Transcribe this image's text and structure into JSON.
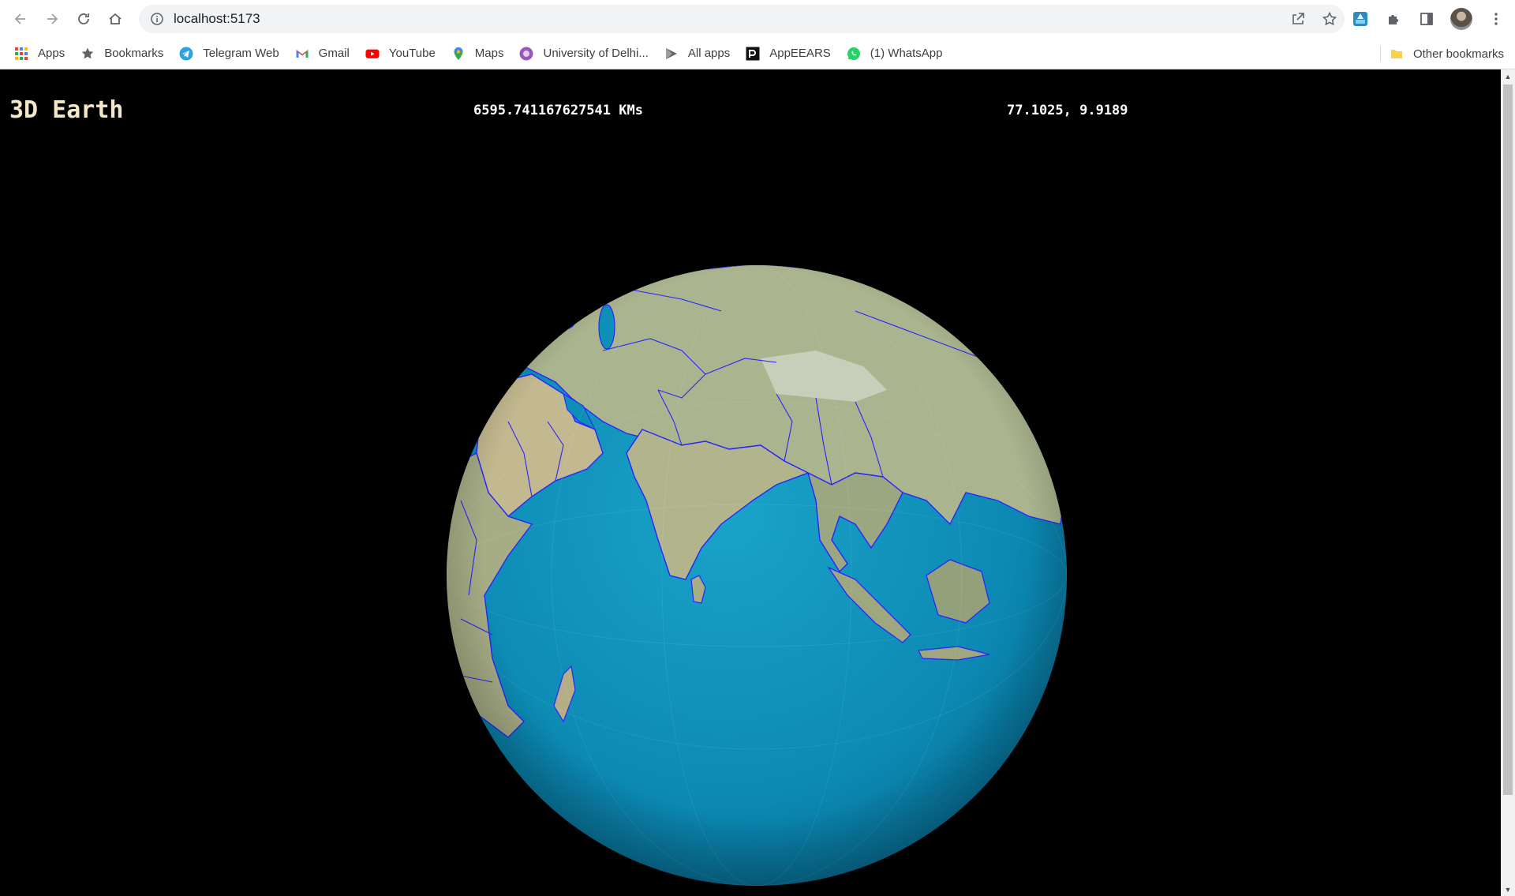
{
  "browser": {
    "url": "localhost:5173",
    "nav": {
      "back_icon": "arrow-left-icon",
      "forward_icon": "arrow-right-icon",
      "reload_icon": "reload-icon",
      "home_icon": "home-icon"
    },
    "omnibox_icons": [
      "info-icon",
      "share-icon",
      "star-icon"
    ],
    "extension_icons": [
      "appeears-extension-icon",
      "puzzle-icon",
      "side-panel-icon",
      "profile-avatar",
      "kebab-menu-icon"
    ]
  },
  "bookmarks": {
    "items": [
      {
        "label": "Apps",
        "icon": "apps-grid-icon",
        "color": "#4285f4"
      },
      {
        "label": "Bookmarks",
        "icon": "star-icon",
        "color": "#5f6368"
      },
      {
        "label": "Telegram Web",
        "icon": "telegram-icon",
        "color": "#2aa3df"
      },
      {
        "label": "Gmail",
        "icon": "gmail-icon",
        "color": "#ea4335"
      },
      {
        "label": "YouTube",
        "icon": "youtube-icon",
        "color": "#ff0000"
      },
      {
        "label": "Maps",
        "icon": "maps-pin-icon",
        "color": "#34a853"
      },
      {
        "label": "University of Delhi...",
        "icon": "university-icon",
        "color": "#9b59b6"
      },
      {
        "label": "All apps",
        "icon": "all-apps-icon",
        "color": "#5f6368"
      },
      {
        "label": "AppEEARS",
        "icon": "appeears-icon",
        "color": "#111111"
      },
      {
        "label": "(1) WhatsApp",
        "icon": "whatsapp-icon",
        "color": "#25d366"
      }
    ],
    "other": {
      "label": "Other bookmarks",
      "icon": "folder-icon",
      "color": "#fbd14b"
    }
  },
  "app": {
    "title": "3D Earth",
    "distance": "6595.741167627541 KMs",
    "coordinates": "77.1025, 9.9189"
  },
  "colors": {
    "ocean": "#0d8fb8",
    "land": "#a9b08a",
    "borders": "#2a23ff",
    "title": "#f5e7c9"
  }
}
